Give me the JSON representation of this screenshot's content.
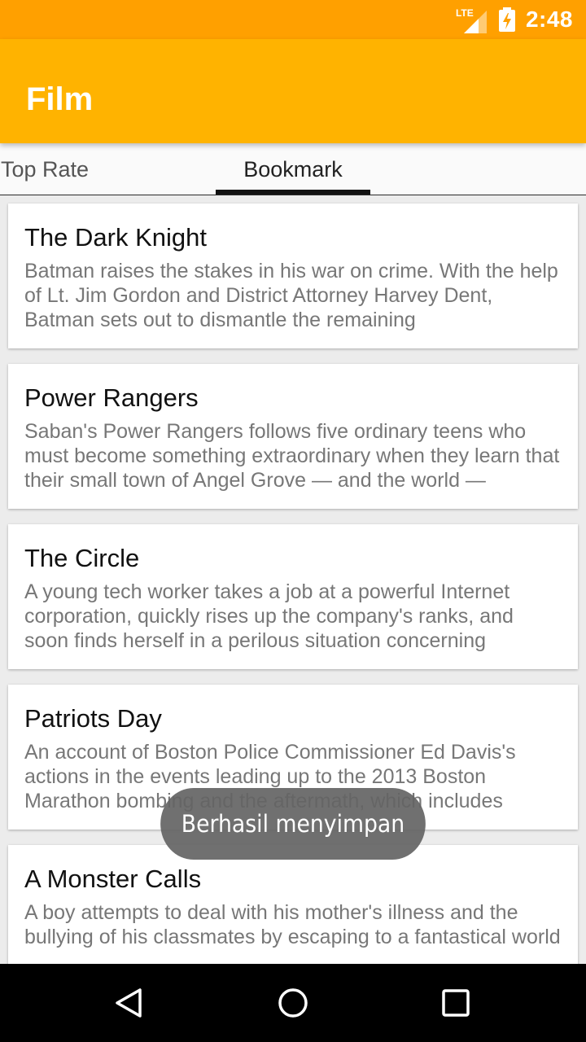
{
  "status_bar": {
    "network_label": "LTE",
    "time": "2:48"
  },
  "app_bar": {
    "title": "Film"
  },
  "tabs": [
    {
      "label": "Top Rate",
      "selected": false
    },
    {
      "label": "Bookmark",
      "selected": true
    }
  ],
  "movies": [
    {
      "title": "The Dark Knight",
      "overview": "Batman raises the stakes in his war on crime. With the help of Lt. Jim Gordon and District Attorney Harvey Dent, Batman sets out to dismantle the remaining"
    },
    {
      "title": "Power Rangers",
      "overview": "Saban's Power Rangers follows five ordinary teens who must become something extraordinary when they learn that their small town of Angel Grove — and the world —"
    },
    {
      "title": "The Circle",
      "overview": "A young tech worker takes a job at a powerful Internet corporation, quickly rises up the company's ranks, and soon finds herself in a perilous situation concerning"
    },
    {
      "title": "Patriots Day",
      "overview": "An account of Boston Police Commissioner Ed Davis's actions in the events leading up to the 2013 Boston Marathon bombing and the aftermath, which includes"
    },
    {
      "title": "A Monster Calls",
      "overview": "A boy attempts to deal with his mother's illness and the bullying of his classmates by escaping to a fantastical world"
    }
  ],
  "toast": {
    "message": "Berhasil menyimpan"
  },
  "colors": {
    "status_bar": "#ffa000",
    "app_bar": "#ffb300",
    "nav_bar": "#000000"
  },
  "nav_bar": {
    "icons": [
      "back-icon",
      "home-icon",
      "recents-icon"
    ]
  }
}
